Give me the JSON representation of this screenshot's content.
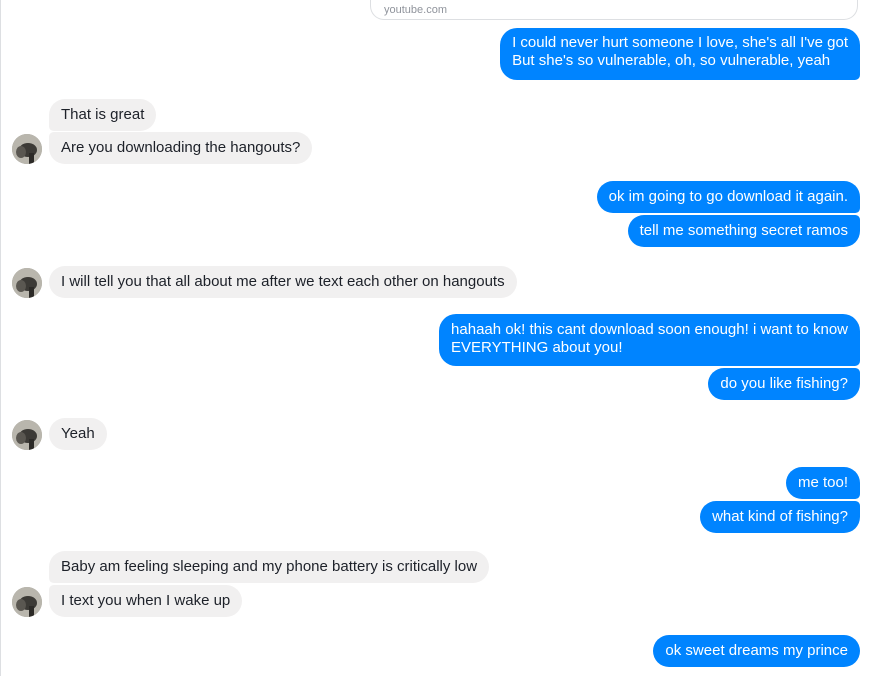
{
  "link_preview": {
    "domain": "youtube.com"
  },
  "messages": [
    {
      "side": "out",
      "text": "I could never hurt someone I love, she's all I've got"
    },
    {
      "side": "out",
      "text": "But she's so vulnerable, oh, so vulnerable, yeah"
    },
    {
      "side": "in",
      "text": "That is great"
    },
    {
      "side": "in",
      "text": "Are you downloading the hangouts?"
    },
    {
      "side": "out",
      "text": "ok im going to go download it again."
    },
    {
      "side": "out",
      "text": "tell me something secret ramos"
    },
    {
      "side": "in",
      "text": "I will tell you that all about me after we text each other on hangouts"
    },
    {
      "side": "out",
      "text": "hahaah ok! this cant download soon enough! i want to know"
    },
    {
      "side": "out",
      "text": "EVERYTHING about you!"
    },
    {
      "side": "out",
      "text": "do you like fishing?"
    },
    {
      "side": "in",
      "text": "Yeah"
    },
    {
      "side": "out",
      "text": "me too!"
    },
    {
      "side": "out",
      "text": "what kind of fishing?"
    },
    {
      "side": "in",
      "text": "Baby am feeling sleeping and my phone battery is critically low"
    },
    {
      "side": "in",
      "text": "I text you when I wake up"
    },
    {
      "side": "out",
      "text": "ok sweet dreams my prince"
    }
  ],
  "colors": {
    "outgoing_bubble": "#0084ff",
    "incoming_bubble": "#f1f0f0"
  }
}
